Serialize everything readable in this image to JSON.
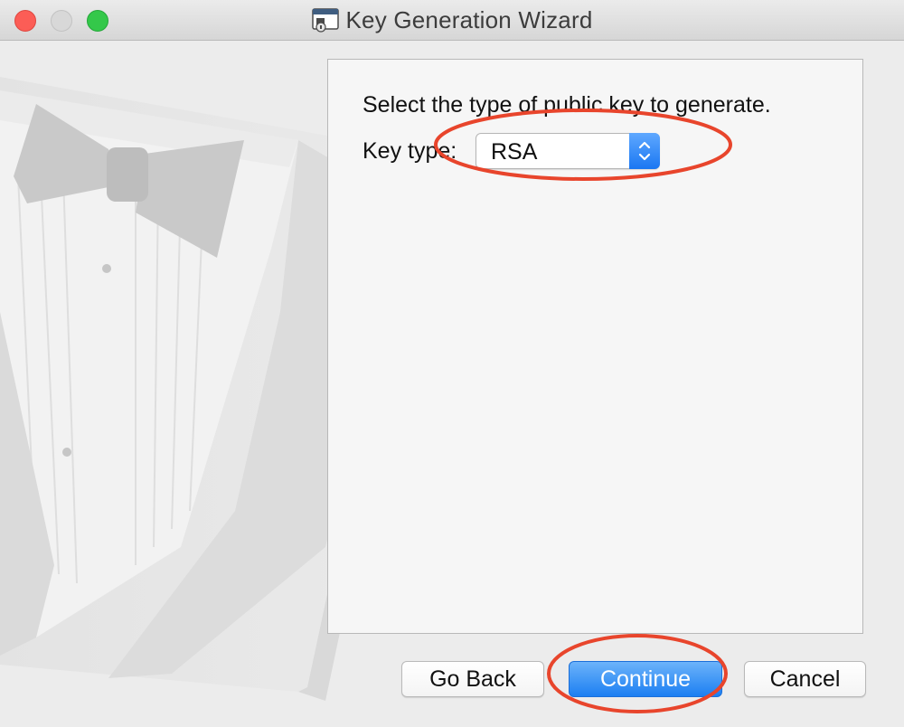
{
  "window": {
    "title": "Key Generation Wizard"
  },
  "wizard": {
    "prompt": "Select the type of public key to generate.",
    "key_type_label": "Key type:",
    "key_type_value": "RSA"
  },
  "buttons": {
    "back": "Go Back",
    "continue": "Continue",
    "cancel": "Cancel"
  },
  "colors": {
    "accent": "#1c7ff2",
    "annotation": "#e8452c"
  }
}
